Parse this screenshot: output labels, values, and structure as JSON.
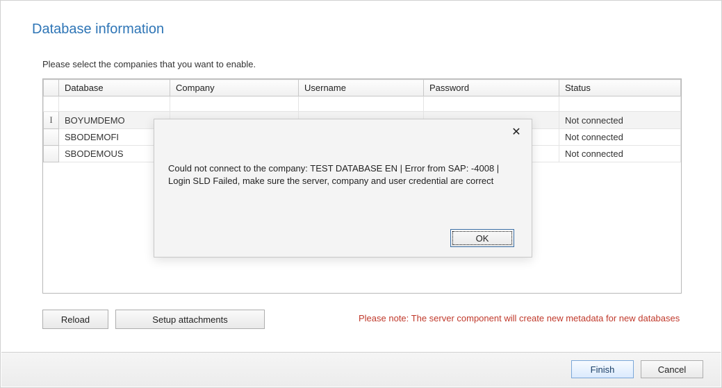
{
  "heading": "Database information",
  "instruction": "Please select the companies that you want to enable.",
  "columns": {
    "database": "Database",
    "company": "Company",
    "username": "Username",
    "password": "Password",
    "status": "Status"
  },
  "rows": [
    {
      "handle": "I",
      "database": "BOYUMDEMO",
      "company": "",
      "username": "",
      "password": "",
      "status": "Not connected",
      "selected": true
    },
    {
      "handle": "",
      "database": "SBODEMOFI",
      "company": "",
      "username": "",
      "password": "",
      "status": "Not connected",
      "selected": false
    },
    {
      "handle": "",
      "database": "SBODEMOUS",
      "company": "",
      "username": "",
      "password": "",
      "status": "Not connected",
      "selected": false
    }
  ],
  "buttons": {
    "reload": "Reload",
    "setup_attachments": "Setup attachments",
    "finish": "Finish",
    "cancel": "Cancel",
    "ok": "OK"
  },
  "note": "Please note: The server component will create new metadata for new databases",
  "dialog": {
    "message": "Could not connect to the company: TEST DATABASE EN | Error from SAP: -4008 | Login SLD Failed, make sure the server, company and user credential are correct",
    "close_glyph": "✕"
  }
}
